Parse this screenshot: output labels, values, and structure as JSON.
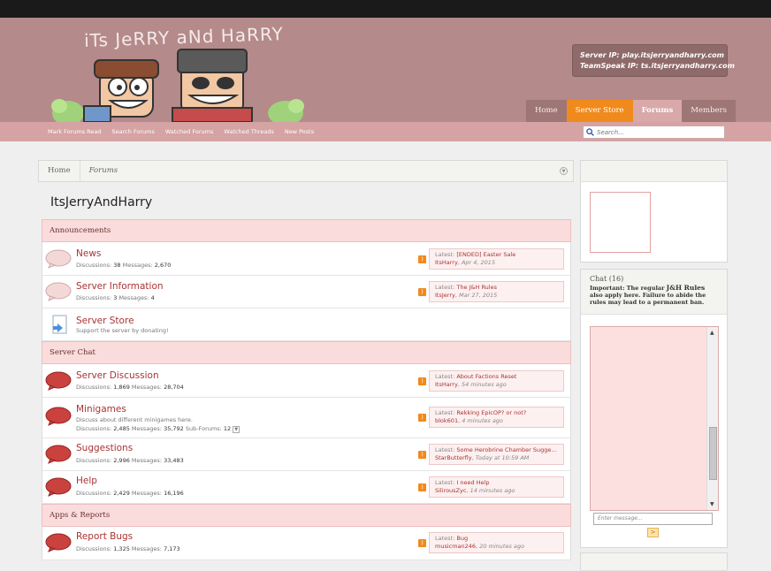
{
  "header": {
    "logo_text": "iTs JeRRY aNd HaRRY",
    "server_ip": "Server IP: play.itsjerryandharry.com",
    "teamspeak_ip": "TeamSpeak IP: ts.itsjerryandharry.com"
  },
  "nav": {
    "tabs": [
      "Home",
      "Server Store",
      "Forums",
      "Members"
    ],
    "active": "Forums"
  },
  "subnav": {
    "links": [
      "Mark Forums Read",
      "Search Forums",
      "Watched Forums",
      "Watched Threads",
      "New Posts"
    ]
  },
  "search": {
    "placeholder": "Search..."
  },
  "breadcrumb": [
    "Home",
    "Forums"
  ],
  "page_title": "ItsJerryAndHarry",
  "categories": [
    {
      "title": "Announcements",
      "nodes": [
        {
          "title": "News",
          "description": "",
          "stats": {
            "discussions_label": "Discussions:",
            "discussions": "38",
            "messages_label": "Messages:",
            "messages": "2,670"
          },
          "latest": {
            "label": "Latest:",
            "title": "[ENDED] Easter Sale",
            "user": "ItsHarry",
            "time": "Apr 4, 2015"
          }
        },
        {
          "title": "Server Information",
          "description": "",
          "stats": {
            "discussions_label": "Discussions:",
            "discussions": "3",
            "messages_label": "Messages:",
            "messages": "4"
          },
          "latest": {
            "label": "Latest:",
            "title": "The J&H Rules",
            "user": "ItsJerry",
            "time": "Mar 27, 2015"
          }
        },
        {
          "title": "Server Store",
          "description": "Support the server by donating!"
        }
      ]
    },
    {
      "title": "Server Chat",
      "nodes": [
        {
          "title": "Server Discussion",
          "description": "",
          "stats": {
            "discussions_label": "Discussions:",
            "discussions": "1,869",
            "messages_label": "Messages:",
            "messages": "28,704"
          },
          "latest": {
            "label": "Latest:",
            "title": "About Factions Reset",
            "user": "ItsHarry",
            "time": "54 minutes ago"
          }
        },
        {
          "title": "Minigames",
          "description": "Discuss about different minigames here.",
          "stats": {
            "discussions_label": "Discussions:",
            "discussions": "2,485",
            "messages_label": "Messages:",
            "messages": "35,792",
            "subforums_label": "Sub-Forums:",
            "subforums": "12"
          },
          "latest": {
            "label": "Latest:",
            "title": "Rekking EpicOP? or not?",
            "user": "blok601",
            "time": "4 minutes ago"
          }
        },
        {
          "title": "Suggestions",
          "description": "",
          "stats": {
            "discussions_label": "Discussions:",
            "discussions": "2,996",
            "messages_label": "Messages:",
            "messages": "33,483"
          },
          "latest": {
            "label": "Latest:",
            "title": "Some Herobrine Chamber Sugge...",
            "user": "StarButterfly",
            "time": "Today at 10:59 AM"
          }
        },
        {
          "title": "Help",
          "description": "",
          "stats": {
            "discussions_label": "Discussions:",
            "discussions": "2,429",
            "messages_label": "Messages:",
            "messages": "16,196"
          },
          "latest": {
            "label": "Latest:",
            "title": "I need Help",
            "user": "SilirousZyc",
            "time": "14 minutes ago"
          }
        }
      ]
    },
    {
      "title": "Apps & Reports",
      "nodes": [
        {
          "title": "Report Bugs",
          "description": "",
          "stats": {
            "discussions_label": "Discussions:",
            "discussions": "1,325",
            "messages_label": "Messages:",
            "messages": "7,173"
          },
          "latest": {
            "label": "Latest:",
            "title": "Bug",
            "user": "musicman246",
            "time": "20 minutes ago"
          }
        }
      ]
    }
  ],
  "chat": {
    "title": "Chat (16)",
    "note_important": "Important:",
    "note_text_1": "The regular",
    "note_rules": "J&H Rules",
    "note_text_2": "also apply here. Failure to abide the rules may lead to a permanent ban.",
    "input_placeholder": "Enter message...",
    "send_label": ">",
    "scroll_position": 0.82
  },
  "colors": {
    "header_bg": "#b48a8a",
    "subnav_bg": "#d5a3a3",
    "accent_orange": "#f08a1c",
    "category_bg": "#fbdcdc",
    "link_red": "#aa3333"
  }
}
